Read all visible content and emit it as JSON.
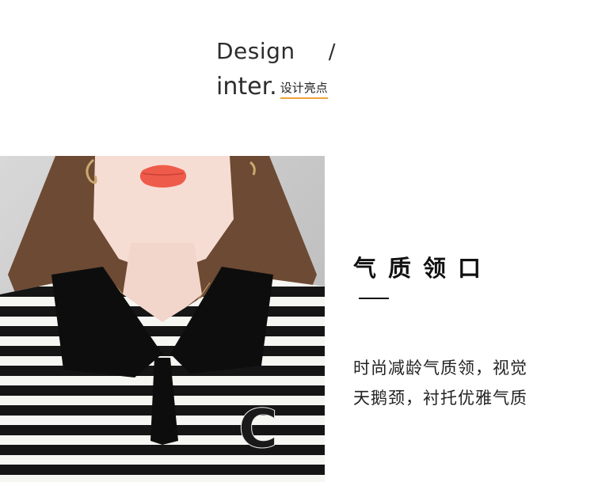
{
  "header": {
    "title_en": "Design",
    "slash": "/",
    "title_en2": "inter.",
    "subtitle_cn": "设计亮点",
    "underline_color": "#f2a23a"
  },
  "feature": {
    "title": "气质领口",
    "description_lines": [
      "时尚减龄气质领，视觉",
      "天鹅颈，衬托优雅气质"
    ]
  },
  "photo": {
    "logo_letter": "C"
  }
}
